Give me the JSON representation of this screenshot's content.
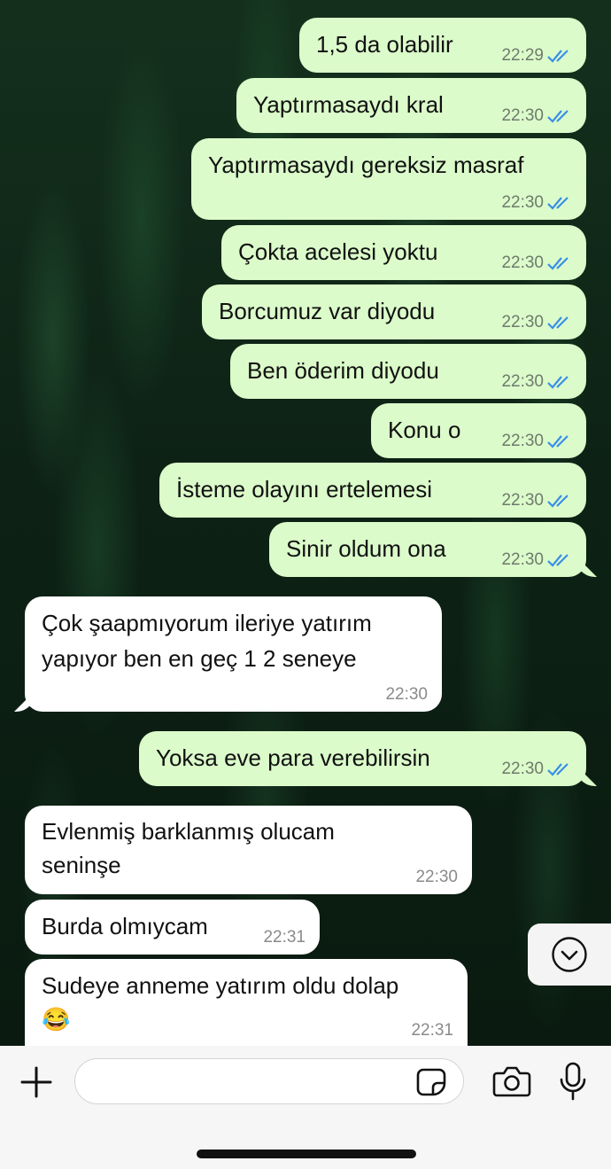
{
  "chat": {
    "messages": [
      {
        "dir": "out",
        "text": "1,5 da olabilir",
        "time": "22:29",
        "status": "read"
      },
      {
        "dir": "out",
        "text": "Yaptırmasaydı kral",
        "time": "22:30",
        "status": "read"
      },
      {
        "dir": "out",
        "text": "Yaptırmasaydı gereksiz masraf",
        "time": "22:30",
        "status": "read"
      },
      {
        "dir": "out",
        "text": "Çokta acelesi yoktu",
        "time": "22:30",
        "status": "read"
      },
      {
        "dir": "out",
        "text": "Borcumuz var diyodu",
        "time": "22:30",
        "status": "read"
      },
      {
        "dir": "out",
        "text": "Ben öderim diyodu",
        "time": "22:30",
        "status": "read"
      },
      {
        "dir": "out",
        "text": "Konu o",
        "time": "22:30",
        "status": "read"
      },
      {
        "dir": "out",
        "text": "İsteme olayını ertelemesi",
        "time": "22:30",
        "status": "read"
      },
      {
        "dir": "out",
        "text": "Sinir oldum ona",
        "time": "22:30",
        "status": "read"
      },
      {
        "dir": "in",
        "line1": "Çok şaapmıyorum ileriye yatırım",
        "line2": "yapıyor ben en geç 1 2 seneye",
        "time": "22:30"
      },
      {
        "dir": "out",
        "text": "Yoksa eve para verebilirsin",
        "time": "22:30",
        "status": "read"
      },
      {
        "dir": "in",
        "line1": "Evlenmiş barklanmış olucam",
        "line2": "seninşe",
        "time": "22:30"
      },
      {
        "dir": "in",
        "text": "Burda olmıycam",
        "time": "22:31"
      },
      {
        "dir": "in",
        "line1": "Sudeye anneme yatırım oldu dolap",
        "emoji": "😂",
        "time": "22:31"
      }
    ]
  },
  "icons": {
    "scroll_down": "chevron-down-icon",
    "attach": "plus-icon",
    "sticker": "sticker-icon",
    "camera": "camera-icon",
    "mic": "microphone-icon"
  },
  "colors": {
    "outgoing_bubble": "#dbfbca",
    "incoming_bubble": "#ffffff",
    "read_ticks": "#3a8ee8",
    "wallpaper": "#0d2215"
  },
  "composer": {
    "value": "",
    "placeholder": ""
  }
}
